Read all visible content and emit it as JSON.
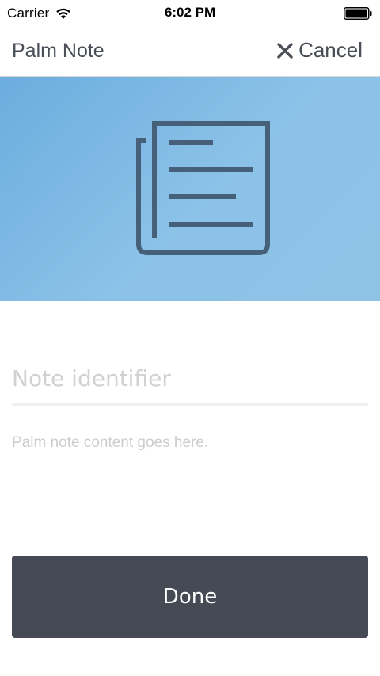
{
  "status_bar": {
    "carrier": "Carrier",
    "time": "6:02 PM",
    "wifi_icon": "wifi-icon",
    "battery_icon": "battery-full-icon"
  },
  "nav": {
    "title": "Palm Note",
    "cancel_label": "Cancel",
    "cancel_icon": "close-icon"
  },
  "banner": {
    "icon": "document-icon",
    "background_color": "#7db8e3",
    "icon_color": "#46607a"
  },
  "form": {
    "identifier_placeholder": "Note identifier",
    "content_placeholder": "Palm note content goes here."
  },
  "actions": {
    "done_label": "Done",
    "done_color": "#454a54"
  }
}
